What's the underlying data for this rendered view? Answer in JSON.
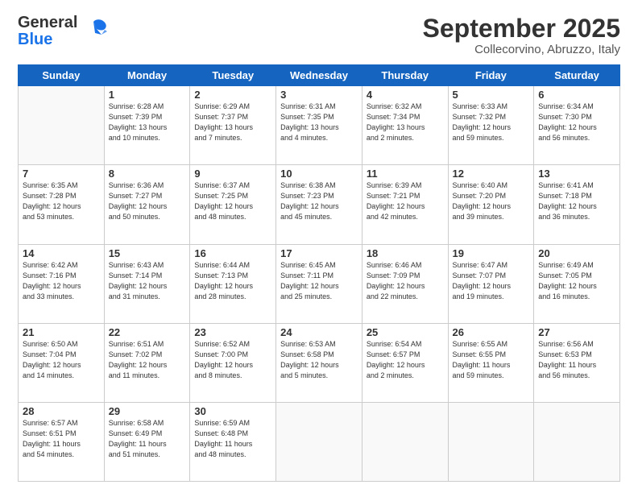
{
  "header": {
    "logo_general": "General",
    "logo_blue": "Blue",
    "month_title": "September 2025",
    "location": "Collecorvino, Abruzzo, Italy"
  },
  "weekdays": [
    "Sunday",
    "Monday",
    "Tuesday",
    "Wednesday",
    "Thursday",
    "Friday",
    "Saturday"
  ],
  "weeks": [
    [
      {
        "day": "",
        "info": ""
      },
      {
        "day": "1",
        "info": "Sunrise: 6:28 AM\nSunset: 7:39 PM\nDaylight: 13 hours\nand 10 minutes."
      },
      {
        "day": "2",
        "info": "Sunrise: 6:29 AM\nSunset: 7:37 PM\nDaylight: 13 hours\nand 7 minutes."
      },
      {
        "day": "3",
        "info": "Sunrise: 6:31 AM\nSunset: 7:35 PM\nDaylight: 13 hours\nand 4 minutes."
      },
      {
        "day": "4",
        "info": "Sunrise: 6:32 AM\nSunset: 7:34 PM\nDaylight: 13 hours\nand 2 minutes."
      },
      {
        "day": "5",
        "info": "Sunrise: 6:33 AM\nSunset: 7:32 PM\nDaylight: 12 hours\nand 59 minutes."
      },
      {
        "day": "6",
        "info": "Sunrise: 6:34 AM\nSunset: 7:30 PM\nDaylight: 12 hours\nand 56 minutes."
      }
    ],
    [
      {
        "day": "7",
        "info": "Sunrise: 6:35 AM\nSunset: 7:28 PM\nDaylight: 12 hours\nand 53 minutes."
      },
      {
        "day": "8",
        "info": "Sunrise: 6:36 AM\nSunset: 7:27 PM\nDaylight: 12 hours\nand 50 minutes."
      },
      {
        "day": "9",
        "info": "Sunrise: 6:37 AM\nSunset: 7:25 PM\nDaylight: 12 hours\nand 48 minutes."
      },
      {
        "day": "10",
        "info": "Sunrise: 6:38 AM\nSunset: 7:23 PM\nDaylight: 12 hours\nand 45 minutes."
      },
      {
        "day": "11",
        "info": "Sunrise: 6:39 AM\nSunset: 7:21 PM\nDaylight: 12 hours\nand 42 minutes."
      },
      {
        "day": "12",
        "info": "Sunrise: 6:40 AM\nSunset: 7:20 PM\nDaylight: 12 hours\nand 39 minutes."
      },
      {
        "day": "13",
        "info": "Sunrise: 6:41 AM\nSunset: 7:18 PM\nDaylight: 12 hours\nand 36 minutes."
      }
    ],
    [
      {
        "day": "14",
        "info": "Sunrise: 6:42 AM\nSunset: 7:16 PM\nDaylight: 12 hours\nand 33 minutes."
      },
      {
        "day": "15",
        "info": "Sunrise: 6:43 AM\nSunset: 7:14 PM\nDaylight: 12 hours\nand 31 minutes."
      },
      {
        "day": "16",
        "info": "Sunrise: 6:44 AM\nSunset: 7:13 PM\nDaylight: 12 hours\nand 28 minutes."
      },
      {
        "day": "17",
        "info": "Sunrise: 6:45 AM\nSunset: 7:11 PM\nDaylight: 12 hours\nand 25 minutes."
      },
      {
        "day": "18",
        "info": "Sunrise: 6:46 AM\nSunset: 7:09 PM\nDaylight: 12 hours\nand 22 minutes."
      },
      {
        "day": "19",
        "info": "Sunrise: 6:47 AM\nSunset: 7:07 PM\nDaylight: 12 hours\nand 19 minutes."
      },
      {
        "day": "20",
        "info": "Sunrise: 6:49 AM\nSunset: 7:05 PM\nDaylight: 12 hours\nand 16 minutes."
      }
    ],
    [
      {
        "day": "21",
        "info": "Sunrise: 6:50 AM\nSunset: 7:04 PM\nDaylight: 12 hours\nand 14 minutes."
      },
      {
        "day": "22",
        "info": "Sunrise: 6:51 AM\nSunset: 7:02 PM\nDaylight: 12 hours\nand 11 minutes."
      },
      {
        "day": "23",
        "info": "Sunrise: 6:52 AM\nSunset: 7:00 PM\nDaylight: 12 hours\nand 8 minutes."
      },
      {
        "day": "24",
        "info": "Sunrise: 6:53 AM\nSunset: 6:58 PM\nDaylight: 12 hours\nand 5 minutes."
      },
      {
        "day": "25",
        "info": "Sunrise: 6:54 AM\nSunset: 6:57 PM\nDaylight: 12 hours\nand 2 minutes."
      },
      {
        "day": "26",
        "info": "Sunrise: 6:55 AM\nSunset: 6:55 PM\nDaylight: 11 hours\nand 59 minutes."
      },
      {
        "day": "27",
        "info": "Sunrise: 6:56 AM\nSunset: 6:53 PM\nDaylight: 11 hours\nand 56 minutes."
      }
    ],
    [
      {
        "day": "28",
        "info": "Sunrise: 6:57 AM\nSunset: 6:51 PM\nDaylight: 11 hours\nand 54 minutes."
      },
      {
        "day": "29",
        "info": "Sunrise: 6:58 AM\nSunset: 6:49 PM\nDaylight: 11 hours\nand 51 minutes."
      },
      {
        "day": "30",
        "info": "Sunrise: 6:59 AM\nSunset: 6:48 PM\nDaylight: 11 hours\nand 48 minutes."
      },
      {
        "day": "",
        "info": ""
      },
      {
        "day": "",
        "info": ""
      },
      {
        "day": "",
        "info": ""
      },
      {
        "day": "",
        "info": ""
      }
    ]
  ]
}
